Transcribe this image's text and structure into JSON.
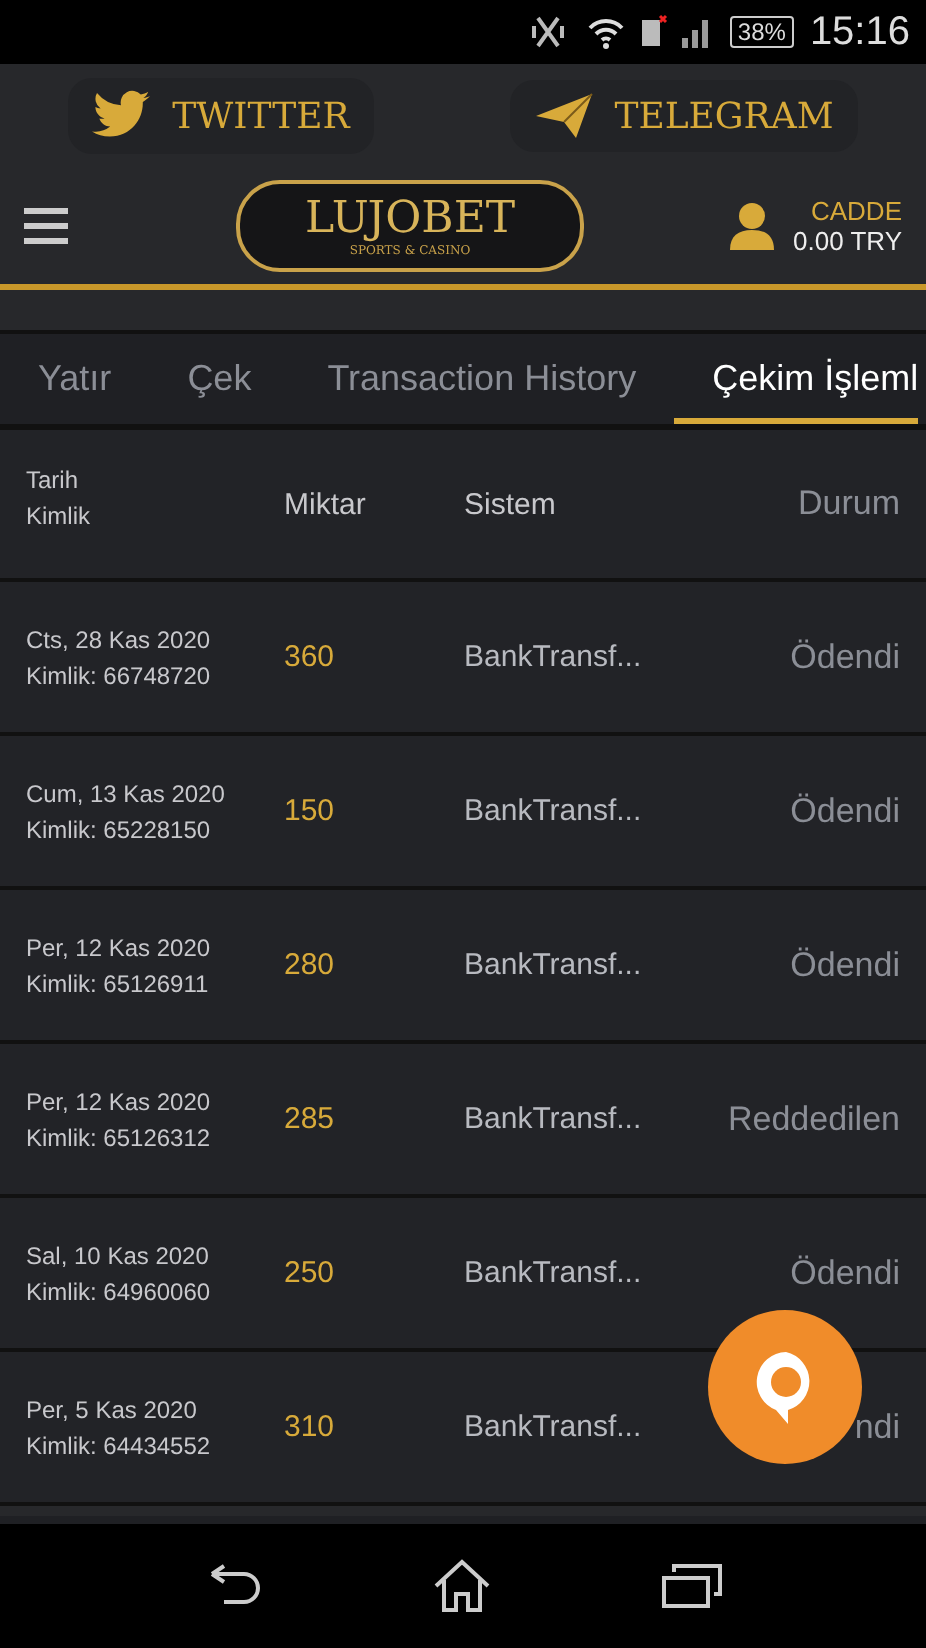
{
  "status_bar": {
    "battery": "38%",
    "time": "15:16"
  },
  "social": [
    {
      "kind": "twitter",
      "label": "TWITTER"
    },
    {
      "kind": "telegram",
      "label": "TELEGRAM"
    }
  ],
  "header": {
    "logo": "LUJOBET",
    "logo_sub": "SPORTS & CASINO",
    "user": "CADDE",
    "balance": "0.00 TRY"
  },
  "tabs": [
    {
      "label": "Yatır",
      "selected": false
    },
    {
      "label": "Çek",
      "selected": false
    },
    {
      "label": "Transaction History",
      "selected": false
    },
    {
      "label": "Çekim İşleml",
      "selected": true
    }
  ],
  "table": {
    "columns": [
      {
        "lines": [
          "Tarih",
          "Kimlik"
        ]
      },
      {
        "lines": [
          "Miktar"
        ]
      },
      {
        "lines": [
          "Sistem"
        ]
      },
      {
        "lines": [
          "Durum"
        ]
      }
    ],
    "rows": [
      {
        "date": "Cts, 28 Kas 2020",
        "id": "Kimlik: 66748720",
        "amount": "360",
        "system": "BankTransf...",
        "status": "Ödendi"
      },
      {
        "date": "Cum, 13 Kas 2020",
        "id": "Kimlik: 65228150",
        "amount": "150",
        "system": "BankTransf...",
        "status": "Ödendi"
      },
      {
        "date": "Per, 12 Kas 2020",
        "id": "Kimlik: 65126911",
        "amount": "280",
        "system": "BankTransf...",
        "status": "Ödendi"
      },
      {
        "date": "Per, 12 Kas 2020",
        "id": "Kimlik: 65126312",
        "amount": "285",
        "system": "BankTransf...",
        "status": "Reddedilen"
      },
      {
        "date": "Sal, 10 Kas 2020",
        "id": "Kimlik: 64960060",
        "amount": "250",
        "system": "BankTransf...",
        "status": "Ödendi"
      },
      {
        "date": "Per, 5 Kas 2020",
        "id": "Kimlik: 64434552",
        "amount": "310",
        "system": "BankTransf...",
        "status": "ndi"
      }
    ]
  }
}
